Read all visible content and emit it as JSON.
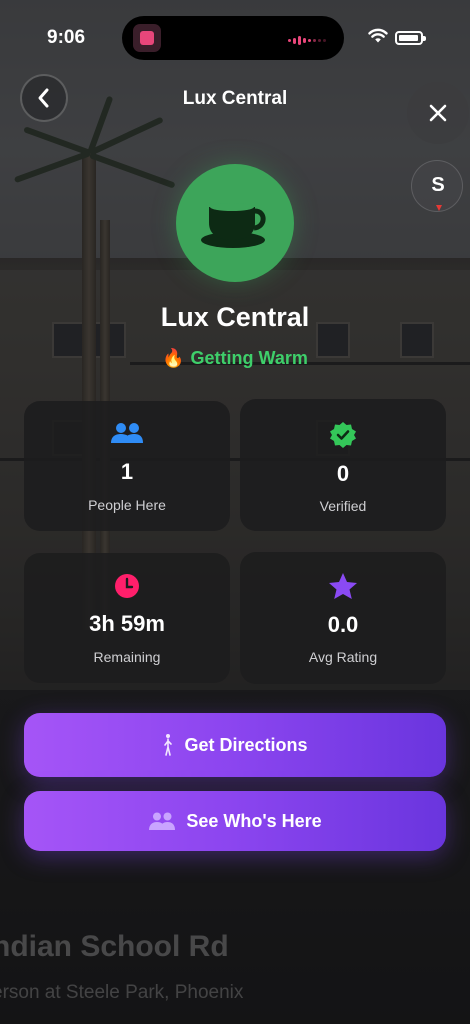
{
  "status_bar": {
    "time": "9:06"
  },
  "header": {
    "title": "Lux Central"
  },
  "compass": {
    "heading": "S"
  },
  "place": {
    "icon": "coffee-cup-icon",
    "name": "Lux Central",
    "status_emoji": "🔥",
    "status_text": "Getting Warm",
    "accent_color": "#3da55a",
    "status_color": "#3ecf6a"
  },
  "stats": [
    {
      "icon": "people-icon",
      "icon_color": "#2f8cf5",
      "value": "1",
      "label": "People Here"
    },
    {
      "icon": "verified-badge-icon",
      "icon_color": "#34c759",
      "value": "0",
      "label": "Verified"
    },
    {
      "icon": "clock-icon",
      "icon_color": "#ff1f6b",
      "value": "3h 59m",
      "label": "Remaining"
    },
    {
      "icon": "star-icon",
      "icon_color": "#8a4af3",
      "value": "0.0",
      "label": "Avg Rating"
    }
  ],
  "actions": {
    "directions_label": "Get Directions",
    "who_label": "See Who's Here",
    "gradient": [
      "#a555f7",
      "#6a35de"
    ]
  },
  "background": {
    "street": "ndian School Rd",
    "subtitle": "erson at Steele Park, Phoenix"
  }
}
